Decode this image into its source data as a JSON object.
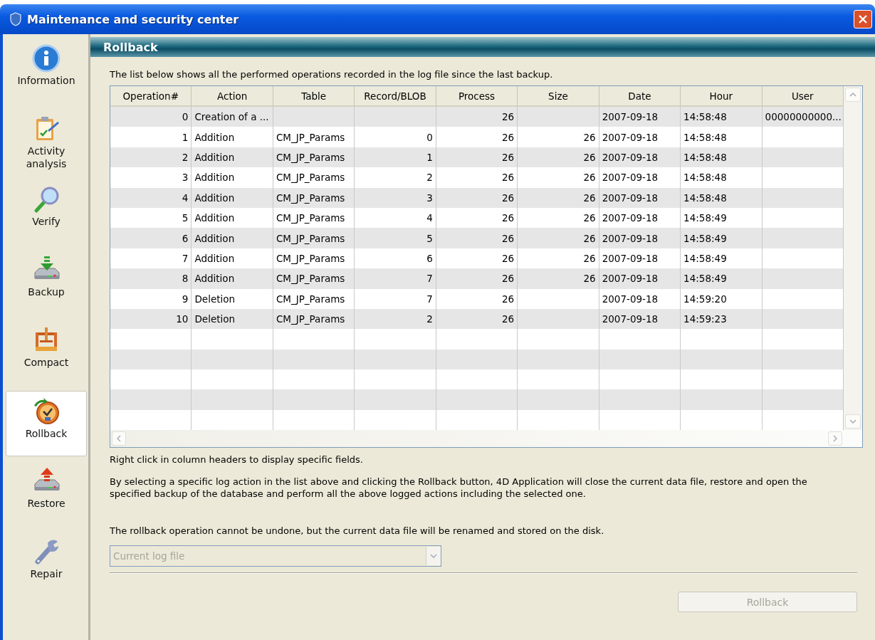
{
  "window": {
    "title": "Maintenance and security center"
  },
  "sidebar": {
    "items": [
      {
        "label": "Information",
        "kind": "info",
        "selected": false
      },
      {
        "label": "Activity\nanalysis",
        "kind": "activity",
        "selected": false
      },
      {
        "label": "Verify",
        "kind": "verify",
        "selected": false
      },
      {
        "label": "Backup",
        "kind": "backup",
        "selected": false
      },
      {
        "label": "Compact",
        "kind": "compact",
        "selected": false
      },
      {
        "label": "Rollback",
        "kind": "rollback",
        "selected": true
      },
      {
        "label": "Restore",
        "kind": "restore",
        "selected": false
      },
      {
        "label": "Repair",
        "kind": "repair",
        "selected": false
      }
    ]
  },
  "panel": {
    "title": "Rollback",
    "intro": "The list below shows all the performed operations recorded in the log file since the last backup."
  },
  "table": {
    "columns": [
      "Operation#",
      "Action",
      "Table",
      "Record/BLOB",
      "Process",
      "Size",
      "Date",
      "Hour",
      "User"
    ],
    "rows": [
      [
        "0",
        "Creation of a ...",
        "",
        "",
        "26",
        "",
        "2007-09-18",
        "14:58:48",
        "00000000000..."
      ],
      [
        "1",
        "Addition",
        "CM_JP_Params",
        "0",
        "26",
        "26",
        "2007-09-18",
        "14:58:48",
        ""
      ],
      [
        "2",
        "Addition",
        "CM_JP_Params",
        "1",
        "26",
        "26",
        "2007-09-18",
        "14:58:48",
        ""
      ],
      [
        "3",
        "Addition",
        "CM_JP_Params",
        "2",
        "26",
        "26",
        "2007-09-18",
        "14:58:48",
        ""
      ],
      [
        "4",
        "Addition",
        "CM_JP_Params",
        "3",
        "26",
        "26",
        "2007-09-18",
        "14:58:48",
        ""
      ],
      [
        "5",
        "Addition",
        "CM_JP_Params",
        "4",
        "26",
        "26",
        "2007-09-18",
        "14:58:49",
        ""
      ],
      [
        "6",
        "Addition",
        "CM_JP_Params",
        "5",
        "26",
        "26",
        "2007-09-18",
        "14:58:49",
        ""
      ],
      [
        "7",
        "Addition",
        "CM_JP_Params",
        "6",
        "26",
        "26",
        "2007-09-18",
        "14:58:49",
        ""
      ],
      [
        "8",
        "Addition",
        "CM_JP_Params",
        "7",
        "26",
        "26",
        "2007-09-18",
        "14:58:49",
        ""
      ],
      [
        "9",
        "Deletion",
        "CM_JP_Params",
        "7",
        "26",
        "",
        "2007-09-18",
        "14:59:20",
        ""
      ],
      [
        "10",
        "Deletion",
        "CM_JP_Params",
        "2",
        "26",
        "",
        "2007-09-18",
        "14:59:23",
        ""
      ]
    ]
  },
  "hint": "Right click in column headers to display specific fields.",
  "description": "By selecting a specific log action in the list above and clicking the Rollback button, 4D Application will close the current data file, restore and open the specified backup of the database and perform all the above logged actions including the selected one.",
  "warning": "The rollback operation cannot be undone, but the current data file will be renamed and stored on the disk.",
  "log_select": {
    "value": "Current log file",
    "disabled": true
  },
  "rollback_button": {
    "label": "Rollback",
    "disabled": true
  }
}
